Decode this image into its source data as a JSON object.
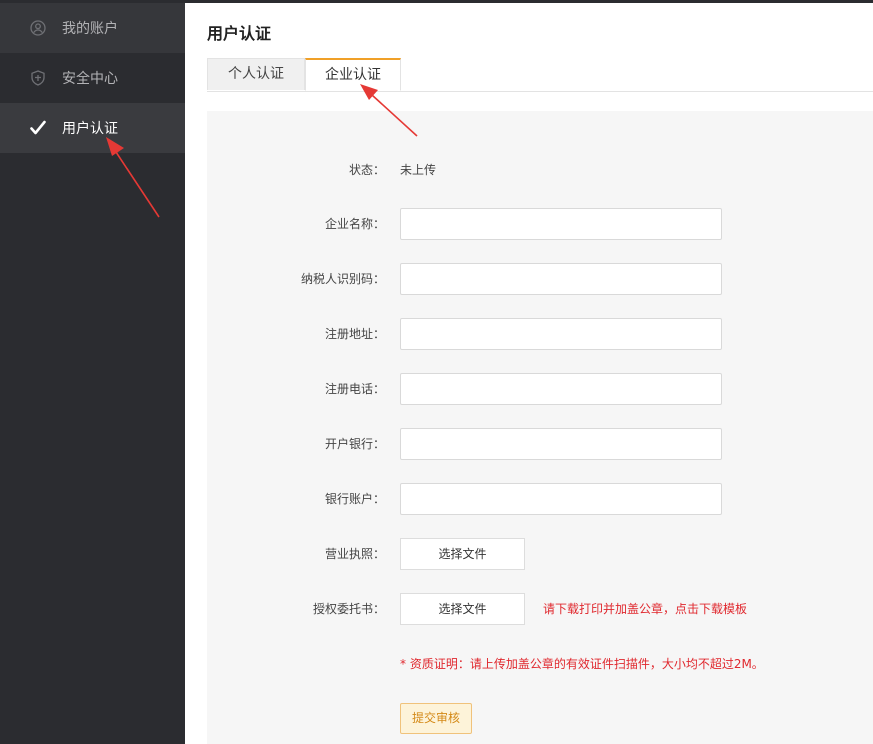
{
  "sidebar": {
    "items": [
      {
        "label": "我的账户",
        "icon": "user-circle-icon"
      },
      {
        "label": "安全中心",
        "icon": "shield-icon"
      },
      {
        "label": "用户认证",
        "icon": "check-icon"
      }
    ],
    "active_index": 2
  },
  "main": {
    "title": "用户认证",
    "tabs": [
      {
        "label": "个人认证"
      },
      {
        "label": "企业认证"
      }
    ],
    "active_tab": 1
  },
  "form": {
    "status": {
      "label": "状态：",
      "value": "未上传"
    },
    "fields": [
      {
        "label": "企业名称：",
        "value": ""
      },
      {
        "label": "纳税人识别码：",
        "value": ""
      },
      {
        "label": "注册地址：",
        "value": ""
      },
      {
        "label": "注册电话：",
        "value": ""
      },
      {
        "label": "开户银行：",
        "value": ""
      },
      {
        "label": "银行账户：",
        "value": ""
      }
    ],
    "license": {
      "label": "营业执照：",
      "button": "选择文件"
    },
    "authorization": {
      "label": "授权委托书：",
      "button": "选择文件",
      "link": "请下载打印并加盖公章，点击下载模板"
    },
    "note": "* 资质证明：请上传加盖公章的有效证件扫描件，大小均不超过2M。",
    "submit": "提交审核"
  },
  "colors": {
    "sidebar_bg": "#2b2c30",
    "accent": "#f0a028",
    "warning_red": "#e0282e",
    "annotation_arrow": "#e53935"
  }
}
